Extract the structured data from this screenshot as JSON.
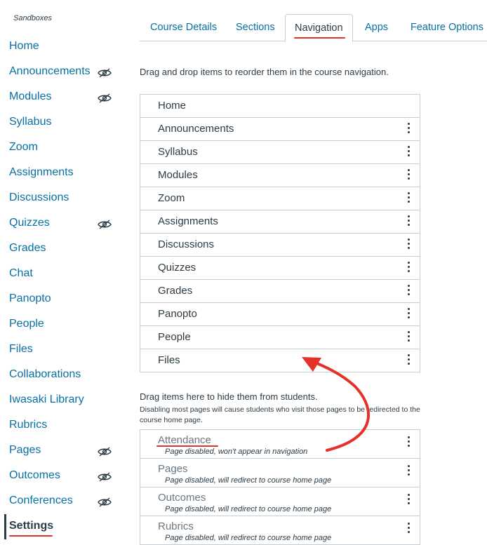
{
  "breadcrumb": "Sandboxes",
  "left_nav": [
    {
      "label": "Home",
      "hidden": false
    },
    {
      "label": "Announcements",
      "hidden": true
    },
    {
      "label": "Modules",
      "hidden": true
    },
    {
      "label": "Syllabus",
      "hidden": false
    },
    {
      "label": "Zoom",
      "hidden": false
    },
    {
      "label": "Assignments",
      "hidden": false
    },
    {
      "label": "Discussions",
      "hidden": false
    },
    {
      "label": "Quizzes",
      "hidden": true
    },
    {
      "label": "Grades",
      "hidden": false
    },
    {
      "label": "Chat",
      "hidden": false
    },
    {
      "label": "Panopto",
      "hidden": false
    },
    {
      "label": "People",
      "hidden": false
    },
    {
      "label": "Files",
      "hidden": false
    },
    {
      "label": "Collaborations",
      "hidden": false
    },
    {
      "label": "Iwasaki Library",
      "hidden": false
    },
    {
      "label": "Rubrics",
      "hidden": false
    },
    {
      "label": "Pages",
      "hidden": true
    },
    {
      "label": "Outcomes",
      "hidden": true
    },
    {
      "label": "Conferences",
      "hidden": true
    },
    {
      "label": "Settings",
      "hidden": false,
      "active": true
    }
  ],
  "tabs": [
    {
      "label": "Course Details"
    },
    {
      "label": "Sections"
    },
    {
      "label": "Navigation",
      "selected": true
    },
    {
      "label": "Apps"
    },
    {
      "label": "Feature Options"
    }
  ],
  "instructions": "Drag and drop items to reorder them in the course navigation.",
  "enabled_items": [
    {
      "label": "Home",
      "menu": false
    },
    {
      "label": "Announcements",
      "menu": true
    },
    {
      "label": "Syllabus",
      "menu": true
    },
    {
      "label": "Modules",
      "menu": true
    },
    {
      "label": "Zoom",
      "menu": true
    },
    {
      "label": "Assignments",
      "menu": true
    },
    {
      "label": "Discussions",
      "menu": true
    },
    {
      "label": "Quizzes",
      "menu": true
    },
    {
      "label": "Grades",
      "menu": true
    },
    {
      "label": "Panopto",
      "menu": true
    },
    {
      "label": "People",
      "menu": true
    },
    {
      "label": "Files",
      "menu": true
    }
  ],
  "hidden_section": {
    "title": "Drag items here to hide them from students.",
    "subtitle": "Disabling most pages will cause students who visit those pages to be redirected to the course home page."
  },
  "disabled_items": [
    {
      "label": "Attendance",
      "note": "Page disabled, won't appear in navigation"
    },
    {
      "label": "Pages",
      "note": "Page disabled, will redirect to course home page"
    },
    {
      "label": "Outcomes",
      "note": "Page disabled, will redirect to course home page"
    },
    {
      "label": "Rubrics",
      "note": "Page disabled, will redirect to course home page"
    }
  ],
  "icons": {
    "hidden_nav": "eye-slash-icon",
    "item_menu": "kebab-menu-icon",
    "annotation": "red-curved-arrow"
  },
  "colors": {
    "link": "#0770a3",
    "text": "#2d3b45",
    "border": "#c7cdd1",
    "annotation": "#e4312a"
  }
}
